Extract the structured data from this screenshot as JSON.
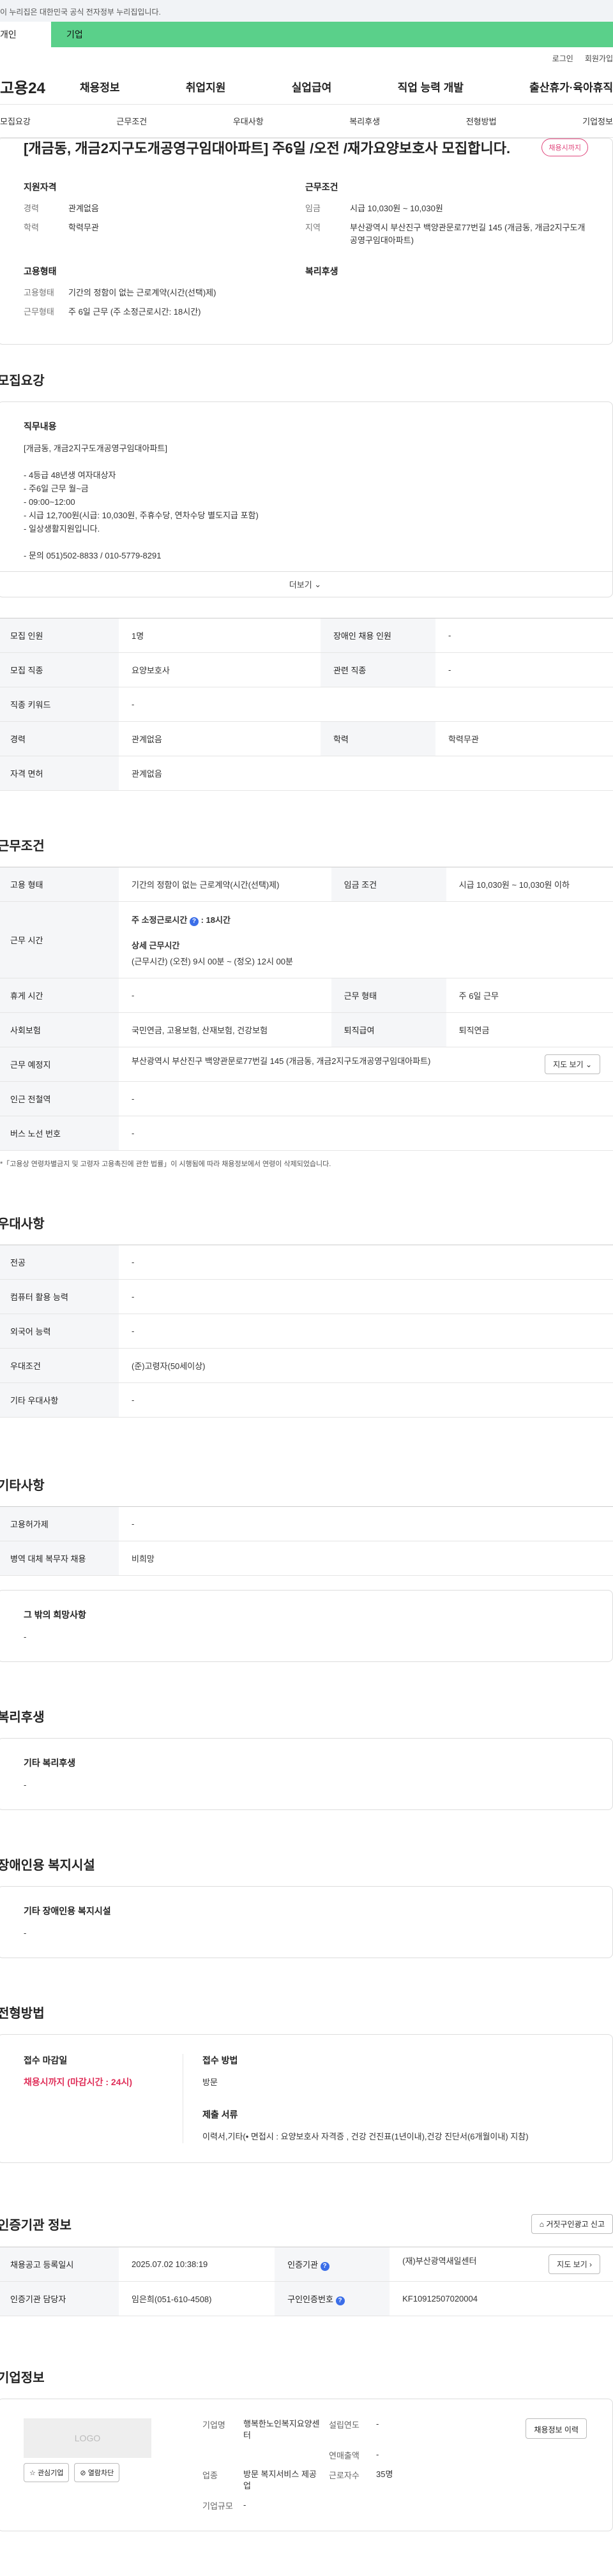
{
  "gov_banner": "이 누리집은 대한민국 공식 전자정부 누리집입니다.",
  "user_tabs": {
    "individual": "개인",
    "company": "기업"
  },
  "util": {
    "login": "로그인",
    "signup": "회원가입"
  },
  "logo": "고용24",
  "gnb": [
    "채용정보",
    "취업지원",
    "실업급여",
    "직업 능력 개발",
    "출산휴가·육아휴직"
  ],
  "anchors": [
    "모집요강",
    "근무조건",
    "우대사항",
    "복리후생",
    "전형방법",
    "기업정보"
  ],
  "job": {
    "title": "[개금동, 개금2지구도개공영구임대아파트] 주6일 /오전 /재가요양보호사 모집합니다.",
    "status": "채용시까지",
    "qual_h": "지원자격",
    "career_k": "경력",
    "career_v": "관계없음",
    "edu_k": "학력",
    "edu_v": "학력무관",
    "cond_h": "근무조건",
    "wage_k": "임금",
    "wage_v": "시급 10,030원 ~ 10,030원",
    "region_k": "지역",
    "region_v": "부산광역시 부산진구 백양관문로77번길 145 (개금동, 개금2지구도개공영구임대아파트)",
    "emp_h": "고용형태",
    "emp_k": "고용형태",
    "emp_v": "기간의 정함이 없는 근로계약(시간(선택)제)",
    "work_k": "근무형태",
    "work_v": "주 6일 근무 (주 소정근로시간: 18시간)",
    "welfare_h": "복리후생"
  },
  "recruit": {
    "title": "모집요강",
    "duty_h": "직무내용",
    "duty_text": "[개금동, 개금2지구도개공영구임대아파트]\n\n- 4등급 48년생 여자대상자\n- 주6일 근무 월~금\n- 09:00~12:00\n- 시급 12,700원(시급: 10,030원, 주휴수당, 연차수당 별도지급 포함)\n- 일상생활지원입니다.\n\n- 문의 051)502-8833 / 010-5779-8291",
    "more": "더보기",
    "rows": {
      "count_k": "모집 인원",
      "count_v": "1명",
      "disabled_k": "장애인 채용 인원",
      "disabled_v": "-",
      "job_k": "모집 직종",
      "job_v": "요양보호사",
      "related_k": "관련 직종",
      "related_v": "-",
      "keyword_k": "직종 키워드",
      "keyword_v": "-",
      "career_k": "경력",
      "career_v": "관계없음",
      "edu_k": "학력",
      "edu_v": "학력무관",
      "license_k": "자격 면허",
      "license_v": "관계없음"
    }
  },
  "conditions": {
    "title": "근무조건",
    "emp_k": "고용 형태",
    "emp_v": "기간의 정함이 없는 근로계약(시간(선택)제)",
    "wage_k": "임금 조건",
    "wage_v": "시급 10,030원 ~ 10,030원 이하",
    "hours_k": "근무 시간",
    "hours_week": "주 소정근로시간",
    "hours_week_v": ": 18시간",
    "hours_detail_h": "상세 근무시간",
    "hours_detail_v": "(근무시간) (오전) 9시 00분 ~ (정오) 12시 00분",
    "break_k": "휴게 시간",
    "break_v": "-",
    "form_k": "근무 형태",
    "form_v": "주 6일 근무",
    "insurance_k": "사회보험",
    "insurance_v": "국민연금, 고용보험, 산재보험, 건강보험",
    "retire_k": "퇴직급여",
    "retire_v": "퇴직연금",
    "place_k": "근무 예정지",
    "place_v": "부산광역시 부산진구 백양관문로77번길 145 (개금동, 개금2지구도개공영구임대아파트)",
    "map_btn": "지도 보기",
    "subway_k": "인근 전철역",
    "subway_v": "-",
    "bus_k": "버스 노선 번호",
    "bus_v": "-",
    "note": "*「고용상 연령차별금지 및 고령자 고용촉진에 관한 법률」이 시행됨에 따라 채용정보에서 연령이 삭제되었습니다."
  },
  "preference": {
    "title": "우대사항",
    "major_k": "전공",
    "major_v": "-",
    "pc_k": "컴퓨터 활용 능력",
    "pc_v": "-",
    "lang_k": "외국어 능력",
    "lang_v": "-",
    "pref_k": "우대조건",
    "pref_v": "(준)고령자(50세이상)",
    "etc_k": "기타 우대사항",
    "etc_v": "-"
  },
  "other": {
    "title": "기타사항",
    "type_k": "고용허가제",
    "type_v": "-",
    "military_k": "병역 대체 복무자 채용",
    "military_v": "비희망",
    "hope_h": "그 밖의 희망사항",
    "hope_v": "-"
  },
  "welfare": {
    "title": "복리후생",
    "etc_h": "기타 복리후생",
    "etc_v": "-"
  },
  "disabled": {
    "title": "장애인용 복지시설",
    "etc_h": "기타 장애인용 복지시설",
    "etc_v": "-"
  },
  "selection": {
    "title": "전형방법",
    "deadline_h": "접수 마감일",
    "deadline_v": "채용시까지 (마감시간 : 24시)",
    "method_h": "접수 방법",
    "method_v": "방문",
    "docs_h": "제출 서류",
    "docs_v": "이력서,기타(• 면접시 : 요양보호사 자격증 , 건강 건진표(1년이내),건강 진단서(6개월이내) 지참)"
  },
  "certification": {
    "title": "인증기관 정보",
    "report_btn": "거짓구인광고 신고",
    "reg_k": "채용공고 등록일시",
    "reg_v": "2025.07.02 10:38:19",
    "org_k": "인증기관",
    "org_v": "(재)부산광역새일센터",
    "next_btn": "지도 보기",
    "manager_k": "인증기관 담당자",
    "manager_v": "임은희(051-610-4508)",
    "num_k": "구인인증번호",
    "num_v": "KF10912507020004"
  },
  "company": {
    "title": "기업정보",
    "logo_text": "LOGO",
    "interest_btn": "관심기업",
    "block_btn": "열람차단",
    "name_k": "기업명",
    "name_v": "행복한노인복지요양센터",
    "found_k": "설립연도",
    "found_v": "-",
    "sales_k": "연매출액",
    "sales_v": "-",
    "industry_k": "업종",
    "industry_v": "방문 복지서비스 제공업",
    "staff_k": "근로자수",
    "staff_v": "35명",
    "scale_k": "기업규모",
    "scale_v": "-",
    "corp_btn": "채용정보 이력"
  }
}
